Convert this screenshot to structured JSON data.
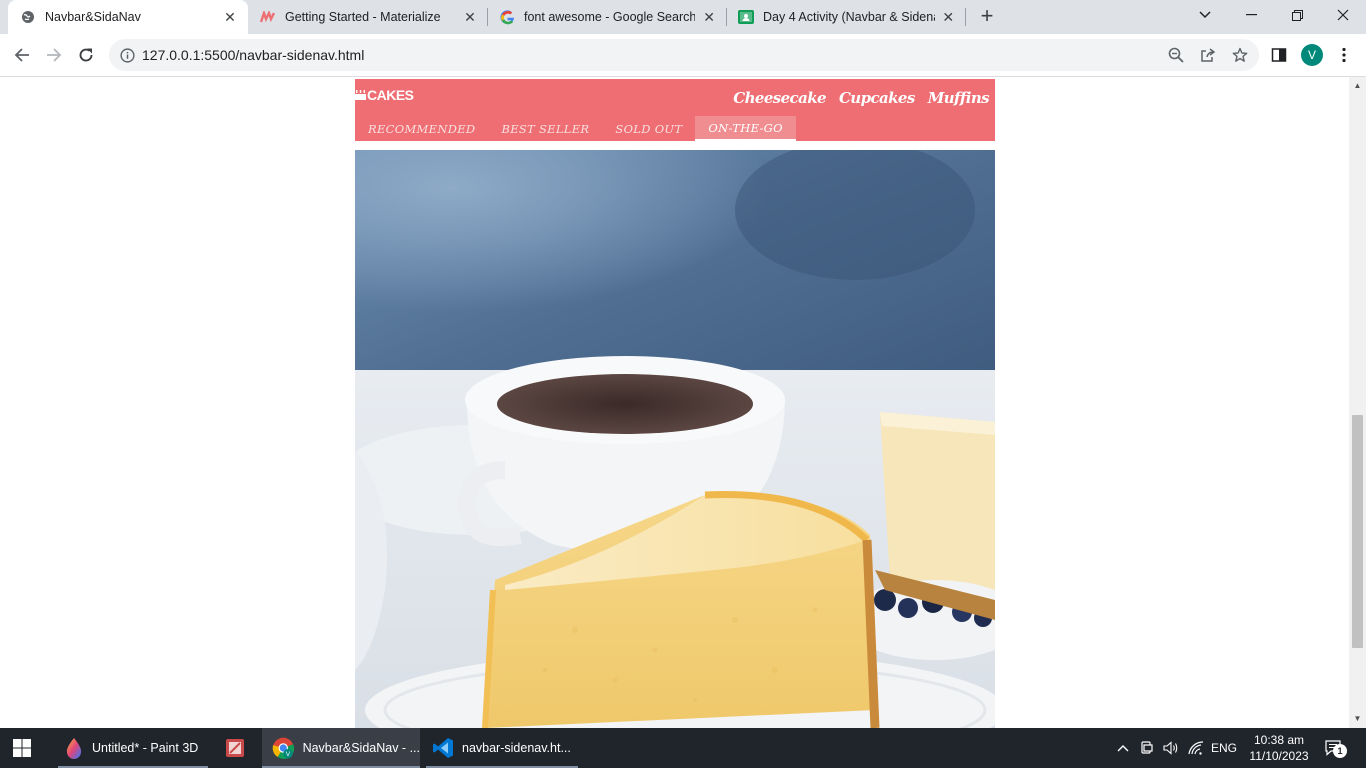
{
  "browser": {
    "tabs": [
      {
        "title": "Navbar&SidaNav",
        "icon": "globe-icon",
        "active": true
      },
      {
        "title": "Getting Started - Materialize",
        "icon": "materialize-icon",
        "active": false
      },
      {
        "title": "font awesome - Google Search",
        "icon": "google-icon",
        "active": false
      },
      {
        "title": "Day 4 Activity (Navbar & Sidena",
        "icon": "classroom-icon",
        "active": false
      }
    ],
    "url": "127.0.0.1:5500/navbar-sidenav.html",
    "profile_initial": "V"
  },
  "page": {
    "brand": "CAKES",
    "nav_links": [
      "Cheesecake",
      "Cupcakes",
      "Muffins"
    ],
    "tabs": [
      "RECOMMENDED",
      "BEST SELLER",
      "SOLD OUT",
      "ON-THE-GO"
    ],
    "active_tab": "ON-THE-GO",
    "navbar_color": "#ee6e73"
  },
  "taskbar": {
    "apps": [
      {
        "label": "Untitled* - Paint 3D",
        "icon": "paint3d-icon"
      },
      {
        "label": "",
        "icon": "snipping-tool-icon"
      },
      {
        "label": "Navbar&SidaNav - ...",
        "icon": "chrome-icon"
      },
      {
        "label": "navbar-sidenav.ht...",
        "icon": "vscode-icon"
      }
    ],
    "language": "ENG",
    "time": "10:38 am",
    "date": "11/10/2023",
    "notification_count": "1"
  }
}
